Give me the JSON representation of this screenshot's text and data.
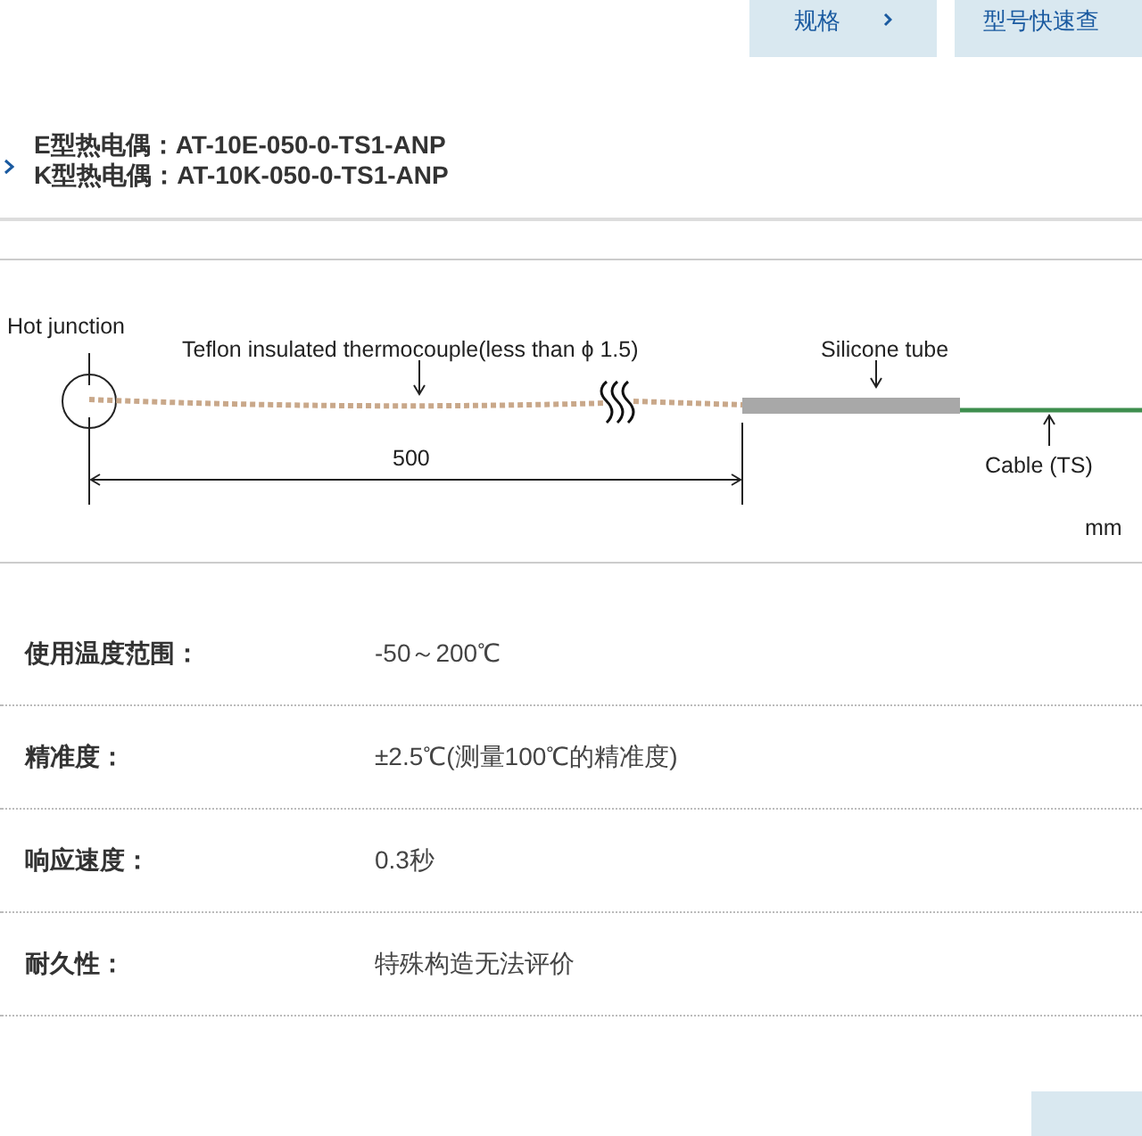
{
  "top_tabs": [
    {
      "label": "规格"
    },
    {
      "label": "型号快速查"
    }
  ],
  "models": [
    "E型热电偶：AT-10E-050-0-TS1-ANP",
    "K型热电偶：AT-10K-050-0-TS1-ANP"
  ],
  "diagram": {
    "hot_junction": "Hot junction",
    "wire_label": "Teflon insulated thermocouple(less than ϕ 1.5)",
    "tube_label": "Silicone tube",
    "length": "500",
    "cable_label": "Cable (TS)",
    "unit": "mm"
  },
  "specs": [
    {
      "label": "使用温度范围：",
      "value": "-50～200℃"
    },
    {
      "label": "精准度：",
      "value": "±2.5℃(测量100℃的精准度)"
    },
    {
      "label": "响应速度：",
      "value": "0.3秒"
    },
    {
      "label": "耐久性：",
      "value": "特殊构造无法评价"
    }
  ]
}
